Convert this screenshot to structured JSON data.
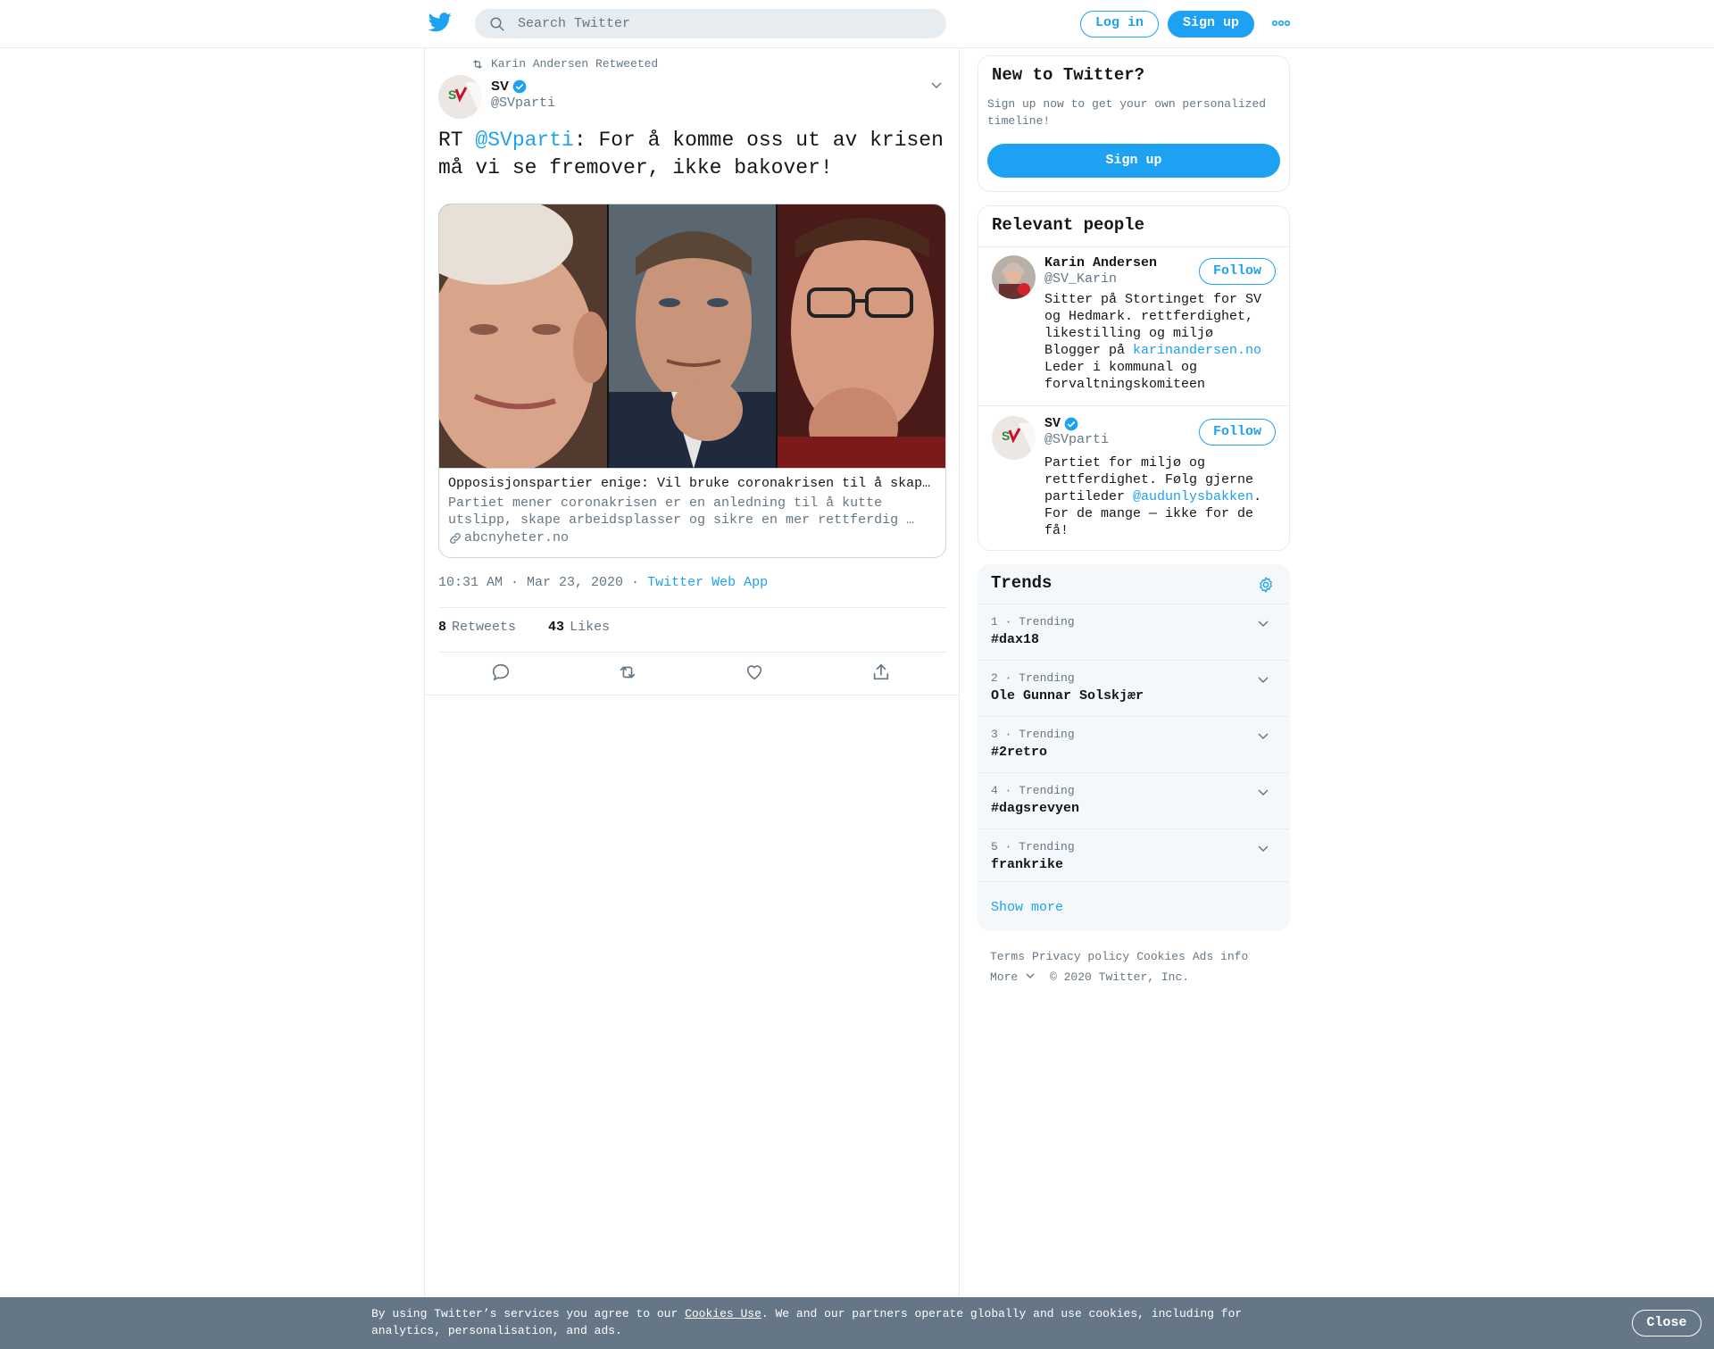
{
  "header": {
    "search_placeholder": "Search Twitter",
    "login_label": "Log in",
    "signup_label": "Sign up"
  },
  "tweet": {
    "retweet_by": "Karin Andersen Retweeted",
    "author_name": "SV",
    "author_handle": "@SVparti",
    "text_prefix": "RT ",
    "text_mention": "@SVparti",
    "text_body": ": For å komme oss ut av krisen må vi se fremover, ikke bakover!",
    "card": {
      "title": "Opposisjonspartier enige: Vil bruke coronakrisen til å skape grønne arbeidsplasser",
      "description": "Partiet mener coronakrisen er en anledning til å kutte utslipp, skape arbeidsplasser og sikre en mer rettferdig …",
      "domain": "abcnyheter.no"
    },
    "time": "10:31 AM · Mar 23, 2020",
    "sep": " · ",
    "app": "Twitter Web App",
    "retweets_count": "8",
    "retweets_label": "Retweets",
    "likes_count": "43",
    "likes_label": "Likes"
  },
  "new_to_twitter": {
    "title": "New to Twitter?",
    "subtitle": "Sign up now to get your own personalized timeline!",
    "button": "Sign up"
  },
  "relevant_people": {
    "title": "Relevant people",
    "people": [
      {
        "name": "Karin Andersen",
        "handle": "@SV_Karin",
        "follow": "Follow",
        "bio_pre": "Sitter på Stortinget for SV og Hedmark. rettferdighet, likestilling og miljø Blogger på ",
        "bio_link": "karinandersen.no",
        "bio_post": " Leder i kommunal og forvaltningskomiteen"
      },
      {
        "name": "SV",
        "handle": "@SVparti",
        "follow": "Follow",
        "bio_pre": "Partiet for miljø og rettferdighet. Følg gjerne partileder ",
        "bio_link": "@audunlysbakken",
        "bio_post": ". For de mange — ikke for de få!"
      }
    ]
  },
  "trends": {
    "title": "Trends",
    "items": [
      {
        "meta": "1 · Trending",
        "name": "#dax18"
      },
      {
        "meta": "2 · Trending",
        "name": "Ole Gunnar Solskjær"
      },
      {
        "meta": "3 · Trending",
        "name": "#2retro"
      },
      {
        "meta": "4 · Trending",
        "name": "#dagsrevyen"
      },
      {
        "meta": "5 · Trending",
        "name": "frankrike"
      }
    ],
    "show_more": "Show more"
  },
  "footer": {
    "links": [
      "Terms",
      "Privacy policy",
      "Cookies",
      "Ads info"
    ],
    "more": "More",
    "copyright": "© 2020 Twitter, Inc."
  },
  "cookie_bar": {
    "text_pre": "By using Twitter’s services you agree to our ",
    "link": "Cookies Use",
    "text_post": ". We and our partners operate globally and use cookies, including for analytics, personalisation, and ads.",
    "close": "Close"
  },
  "colors": {
    "brand_blue": "#1da1f2",
    "secondary_text": "#657786",
    "cookie_bar": "#657786"
  },
  "icons": [
    "twitter-logo-icon",
    "search-icon",
    "more-dots-icon",
    "retweet-icon",
    "verified-icon",
    "chevron-down-icon",
    "link-icon",
    "reply-icon",
    "like-icon",
    "share-icon",
    "gear-icon"
  ]
}
